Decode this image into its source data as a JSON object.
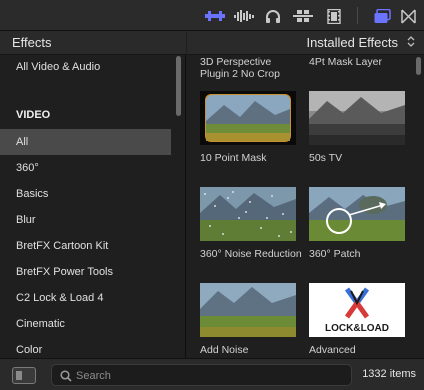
{
  "toolbar": {
    "icons": [
      "audio-video-split-icon",
      "audio-waveform-icon",
      "headphones-icon",
      "video-audio-toggle-icon",
      "film-strip-icon",
      "browser-active-icon",
      "transitions-bowtie-icon"
    ],
    "accent_color": "#6b74ff"
  },
  "left_panel": {
    "title": "Effects",
    "items": [
      {
        "label": "All Video & Audio",
        "type": "item"
      },
      {
        "label": "VIDEO",
        "type": "heading"
      },
      {
        "label": "All",
        "type": "item",
        "selected": true
      },
      {
        "label": "360°",
        "type": "item"
      },
      {
        "label": "Basics",
        "type": "item"
      },
      {
        "label": "Blur",
        "type": "item"
      },
      {
        "label": "BretFX Cartoon Kit",
        "type": "item"
      },
      {
        "label": "BretFX Power Tools",
        "type": "item"
      },
      {
        "label": "C2 Lock & Load 4",
        "type": "item"
      },
      {
        "label": "Cinematic",
        "type": "item"
      },
      {
        "label": "Color",
        "type": "item"
      }
    ]
  },
  "right_panel": {
    "title": "Installed Effects",
    "updown_glyph": "⌃⌄",
    "top_labels": [
      "3D Perspective Plugin 2 No Crop",
      "4Pt Mask Layer"
    ],
    "tiles": [
      {
        "label": "10 Point Mask",
        "thumb": "landscape-masked"
      },
      {
        "label": "50s TV",
        "thumb": "landscape-bw"
      },
      {
        "label": "360° Noise Reduction",
        "thumb": "landscape-noisy"
      },
      {
        "label": "360° Patch",
        "thumb": "landscape-patch"
      },
      {
        "label": "Add Noise",
        "thumb": "landscape"
      },
      {
        "label": "Advanced",
        "thumb": "lock-and-load-logo",
        "logo_text": "LOCK&LOAD"
      }
    ]
  },
  "bottom": {
    "search_placeholder": "Search",
    "item_count": "1332 items"
  }
}
